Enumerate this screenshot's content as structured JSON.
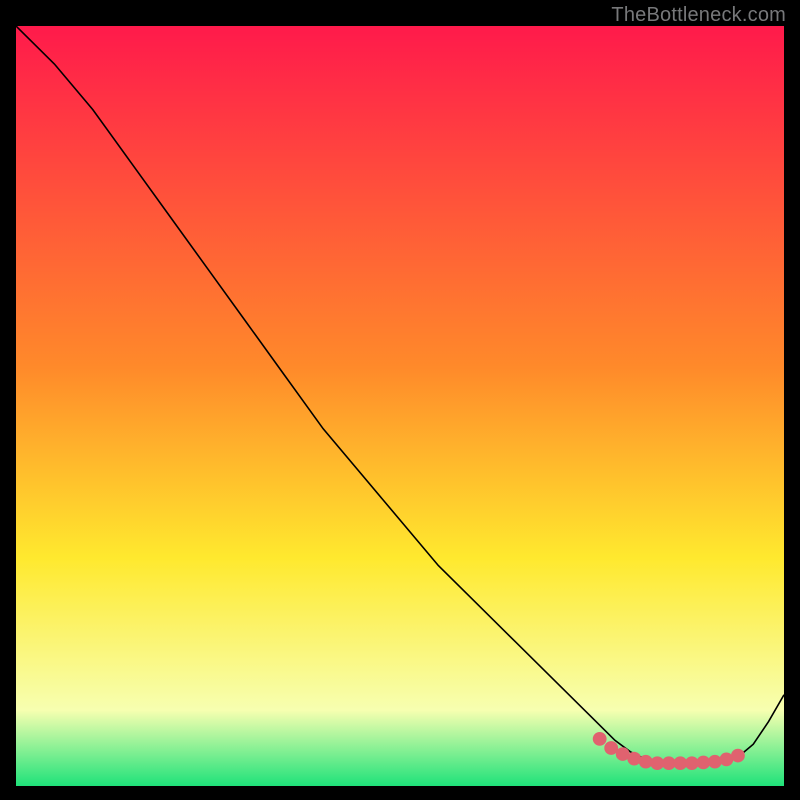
{
  "watermark": "TheBottleneck.com",
  "colors": {
    "curve": "#000000",
    "marker": "#e0626f",
    "grad_top": "#ff1a4b",
    "grad_mid1": "#ff8a2a",
    "grad_mid2": "#ffe92e",
    "grad_low": "#f7ffb0",
    "grad_bottom": "#1fe27a"
  },
  "chart_data": {
    "type": "line",
    "title": "",
    "xlabel": "",
    "ylabel": "",
    "xlim": [
      0,
      100
    ],
    "ylim": [
      0,
      100
    ],
    "curve": {
      "x": [
        0,
        5,
        10,
        15,
        20,
        25,
        30,
        35,
        40,
        45,
        50,
        55,
        60,
        65,
        70,
        75,
        78,
        80,
        82,
        84,
        86,
        88,
        90,
        92,
        94,
        96,
        98,
        100
      ],
      "y": [
        100,
        95,
        89,
        82,
        75,
        68,
        61,
        54,
        47,
        41,
        35,
        29,
        24,
        19,
        14,
        9,
        6,
        4.5,
        3.5,
        3,
        3,
        3,
        3,
        3.2,
        3.8,
        5.5,
        8.5,
        12
      ]
    },
    "markers": {
      "x": [
        76,
        77.5,
        79,
        80.5,
        82,
        83.5,
        85,
        86.5,
        88,
        89.5,
        91,
        92.5,
        94
      ],
      "y": [
        6.2,
        5.0,
        4.2,
        3.6,
        3.2,
        3.0,
        3.0,
        3.0,
        3.0,
        3.1,
        3.2,
        3.5,
        4.0
      ]
    }
  }
}
